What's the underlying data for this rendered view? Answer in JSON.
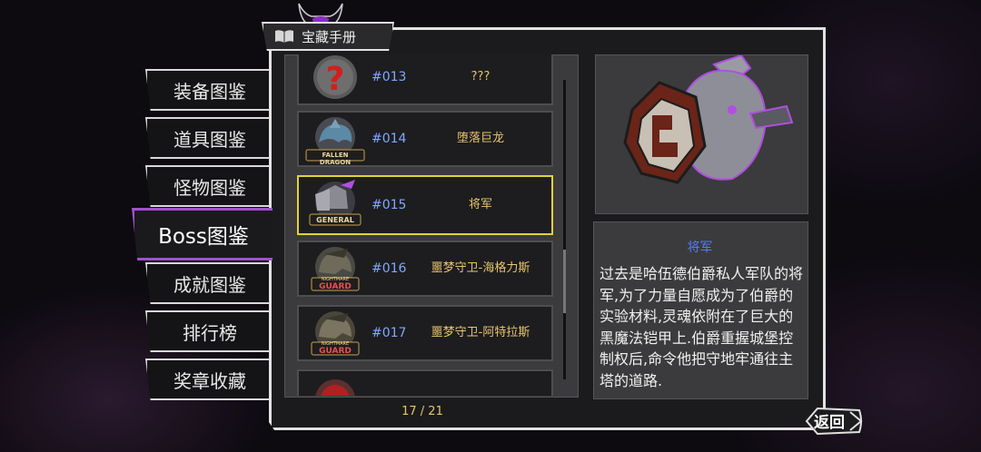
{
  "header": {
    "title": "宝藏手册",
    "book_icon": "book-icon",
    "horn_icon": "demon-horn-icon"
  },
  "tabs": [
    {
      "label": "装备图鉴",
      "active": false
    },
    {
      "label": "道具图鉴",
      "active": false
    },
    {
      "label": "怪物图鉴",
      "active": false
    },
    {
      "label": "Boss图鉴",
      "active": true
    },
    {
      "label": "成就图鉴",
      "active": false
    },
    {
      "label": "排行榜",
      "active": false
    },
    {
      "label": "奖章收藏",
      "active": false
    }
  ],
  "entries": [
    {
      "num": "#013",
      "name": "???",
      "badge": "",
      "icon": "unknown-question-icon"
    },
    {
      "num": "#014",
      "name": "堕落巨龙",
      "badge": "FALLEN DRAGON",
      "icon": "fallen-dragon-portrait"
    },
    {
      "num": "#015",
      "name": "将军",
      "badge": "GENERAL",
      "icon": "general-portrait",
      "selected": true
    },
    {
      "num": "#016",
      "name": "噩梦守卫-海格力斯",
      "badge": "GUARD",
      "badge_top": "NIGHTMARE",
      "icon": "nightmare-guard-portrait"
    },
    {
      "num": "#017",
      "name": "噩梦守卫-阿特拉斯",
      "badge": "GUARD",
      "badge_top": "NIGHTMARE",
      "icon": "nightmare-guard-portrait"
    }
  ],
  "pagination": {
    "text": "17 / 21"
  },
  "detail": {
    "name": "将军",
    "art_icon": "armored-general-art",
    "description": "过去是哈伍德伯爵私人军队的将军,为了力量自愿成为了伯爵的实验材料,灵魂依附在了巨大的黑魔法铠甲上.伯爵重握城堡控制权后,命令他把守地牢通往主塔的道路."
  },
  "back_button": {
    "label": "返回"
  },
  "colors": {
    "accent_selected": "#e1d23a",
    "tab_active_border": "#a24fd0",
    "entry_name": "#e8c56a",
    "entry_num": "#7fa8ff",
    "detail_name": "#4f7bff"
  }
}
